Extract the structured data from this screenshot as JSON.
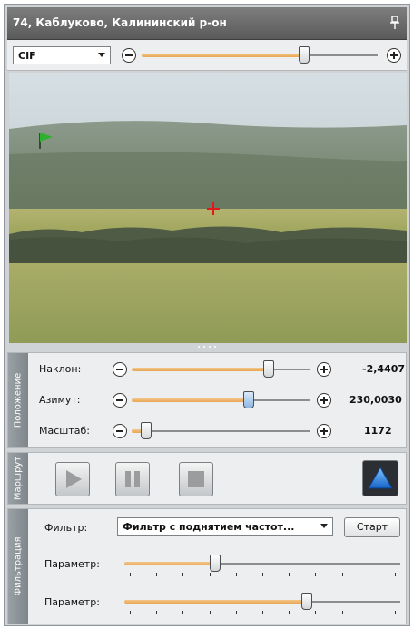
{
  "window": {
    "title": "74, Каблуково, Калининский р-он"
  },
  "video_toolbar": {
    "resolution": "CIF",
    "zoom_level": 0.69
  },
  "position": {
    "section_label": "Положение",
    "rows": [
      {
        "label": "Наклон:",
        "value": "-2,4407",
        "slider": 0.77
      },
      {
        "label": "Азимут:",
        "value": "230,0030",
        "slider": 0.66
      },
      {
        "label": "Масштаб:",
        "value": "1172",
        "slider": 0.08
      }
    ]
  },
  "route": {
    "section_label": "Маршрут"
  },
  "filter": {
    "section_label": "Фильтрация",
    "label": "Фильтр:",
    "selected": "Фильтр с поднятием частот...",
    "start_label": "Старт",
    "params": [
      {
        "label": "Параметр:",
        "slider": 0.33
      },
      {
        "label": "Параметр:",
        "slider": 0.66
      }
    ]
  }
}
